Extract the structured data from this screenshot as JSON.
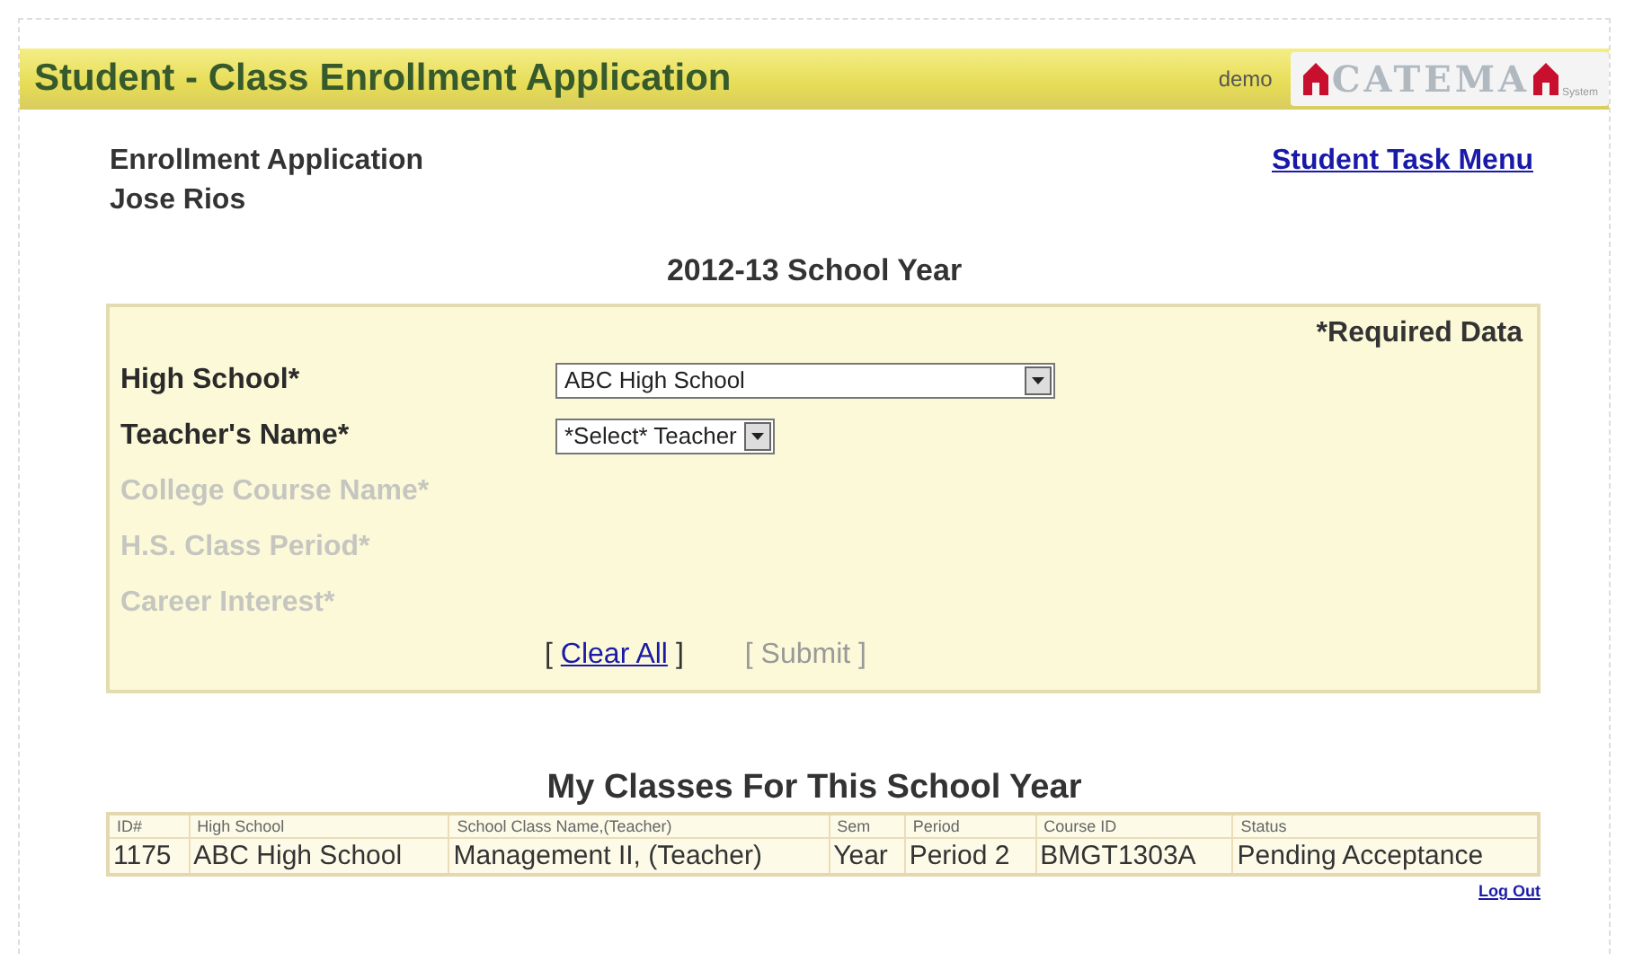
{
  "header": {
    "title": "Student - Class Enrollment Application",
    "user": "demo",
    "logo": {
      "text": "CATEMA",
      "subtext": "System"
    }
  },
  "page": {
    "heading": "Enrollment Application",
    "student": "Jose Rios",
    "menu_link": "Student Task Menu"
  },
  "form": {
    "year_title": "2012-13 School Year",
    "required_note": "*Required Data",
    "fields": [
      {
        "kind": "select",
        "label": "High School*",
        "value": "ABC High School",
        "disabled": false,
        "wide": true
      },
      {
        "kind": "select",
        "label": "Teacher's Name*",
        "value": "*Select* Teacher",
        "disabled": false,
        "wide": false
      },
      {
        "kind": "label",
        "label": "College Course Name*",
        "disabled": true
      },
      {
        "kind": "label",
        "label": "H.S. Class Period*",
        "disabled": true
      },
      {
        "kind": "label",
        "label": "Career Interest*",
        "disabled": true
      }
    ],
    "actions": [
      {
        "open": "[",
        "label": "Clear All",
        "close": "]",
        "disabled": false
      },
      {
        "open": "[",
        "label": "Submit",
        "close": "]",
        "disabled": true
      }
    ]
  },
  "classes": {
    "title": "My Classes For This School Year",
    "columns": [
      "ID#",
      "High School",
      "School Class Name,(Teacher)",
      "Sem",
      "Period",
      "Course ID",
      "Status"
    ],
    "rows": [
      [
        "1175",
        "ABC High School",
        "Management II, (Teacher)",
        "Year",
        "Period 2",
        "BMGT1303A",
        "Pending Acceptance"
      ]
    ]
  },
  "logout": "Log Out"
}
